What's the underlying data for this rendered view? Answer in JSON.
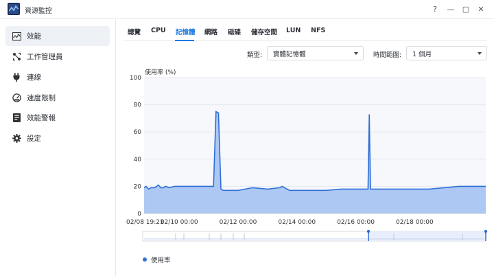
{
  "window": {
    "title": "資源監控",
    "controls": [
      "?",
      "—",
      "▢",
      "✕"
    ]
  },
  "sidebar": {
    "items": [
      {
        "label": "效能",
        "icon": "performance-chart-icon",
        "active": true
      },
      {
        "label": "工作管理員",
        "icon": "task-manager-icon",
        "active": false
      },
      {
        "label": "連線",
        "icon": "plug-icon",
        "active": false
      },
      {
        "label": "速度限制",
        "icon": "speedometer-icon",
        "active": false
      },
      {
        "label": "效能警報",
        "icon": "alert-report-icon",
        "active": false
      },
      {
        "label": "設定",
        "icon": "gear-icon",
        "active": false
      }
    ]
  },
  "tabs": [
    {
      "label": "總覽",
      "active": false
    },
    {
      "label": "CPU",
      "active": false
    },
    {
      "label": "記憶體",
      "active": true
    },
    {
      "label": "網路",
      "active": false
    },
    {
      "label": "磁碟",
      "active": false
    },
    {
      "label": "儲存空間",
      "active": false
    },
    {
      "label": "LUN",
      "active": false
    },
    {
      "label": "NFS",
      "active": false
    }
  ],
  "filters": {
    "type_label": "類型:",
    "type_value": "實體記憶體",
    "range_label": "時間範圍:",
    "range_value": "1 個月"
  },
  "colors": {
    "accent": "#1f7ae0",
    "series_line": "#2f6fd6",
    "series_fill": "#a9c5f1"
  },
  "chart_data": {
    "type": "area",
    "ylabel": "使用率 (%)",
    "ylim": [
      0,
      100
    ],
    "yticks": [
      0,
      20,
      40,
      60,
      80,
      100
    ],
    "xlim": [
      "2025-02-08 19:21",
      "2025-02-20 10:00"
    ],
    "xticks": [
      {
        "label": "02/08 19:21",
        "value": "2025-02-08 19:21"
      },
      {
        "label": "02/10 00:00",
        "value": "2025-02-10 00:00"
      },
      {
        "label": "02/12 00:00",
        "value": "2025-02-12 00:00"
      },
      {
        "label": "02/14 00:00",
        "value": "2025-02-14 00:00"
      },
      {
        "label": "02/16 00:00",
        "value": "2025-02-16 00:00"
      },
      {
        "label": "02/18 00:00",
        "value": "2025-02-18 00:00"
      }
    ],
    "grid": true,
    "legend_position": "bottom-left",
    "series": [
      {
        "name": "使用率",
        "x": [
          "2025-02-08 19:21",
          "2025-02-08 21:00",
          "2025-02-08 23:00",
          "2025-02-09 01:00",
          "2025-02-09 04:00",
          "2025-02-09 07:00",
          "2025-02-09 09:00",
          "2025-02-09 11:00",
          "2025-02-09 13:00",
          "2025-02-09 16:00",
          "2025-02-09 20:00",
          "2025-02-10 00:00",
          "2025-02-10 06:00",
          "2025-02-10 12:00",
          "2025-02-10 18:00",
          "2025-02-11 00:00",
          "2025-02-11 04:00",
          "2025-02-11 06:00",
          "2025-02-11 08:00",
          "2025-02-11 10:00",
          "2025-02-11 12:00",
          "2025-02-11 18:00",
          "2025-02-12 00:00",
          "2025-02-12 12:00",
          "2025-02-13 00:00",
          "2025-02-13 10:00",
          "2025-02-13 12:00",
          "2025-02-13 18:00",
          "2025-02-14 00:00",
          "2025-02-14 12:00",
          "2025-02-15 00:00",
          "2025-02-15 12:00",
          "2025-02-16 00:00",
          "2025-02-16 08:00",
          "2025-02-16 10:00",
          "2025-02-16 11:00",
          "2025-02-16 12:00",
          "2025-02-16 14:00",
          "2025-02-17 00:00",
          "2025-02-17 12:00",
          "2025-02-18 00:00",
          "2025-02-18 12:00",
          "2025-02-19 00:00",
          "2025-02-19 12:00",
          "2025-02-20 00:00",
          "2025-02-20 10:00"
        ],
        "y": [
          19,
          20,
          18,
          19,
          19,
          21,
          19,
          19,
          20,
          19,
          20,
          20,
          20,
          20,
          20,
          20,
          20,
          75,
          74,
          18,
          17,
          17,
          17,
          19,
          18,
          19,
          20,
          17,
          17,
          17,
          17,
          18,
          18,
          18,
          18,
          73,
          18,
          18,
          18,
          18,
          18,
          18,
          19,
          20,
          20,
          20
        ]
      }
    ]
  }
}
